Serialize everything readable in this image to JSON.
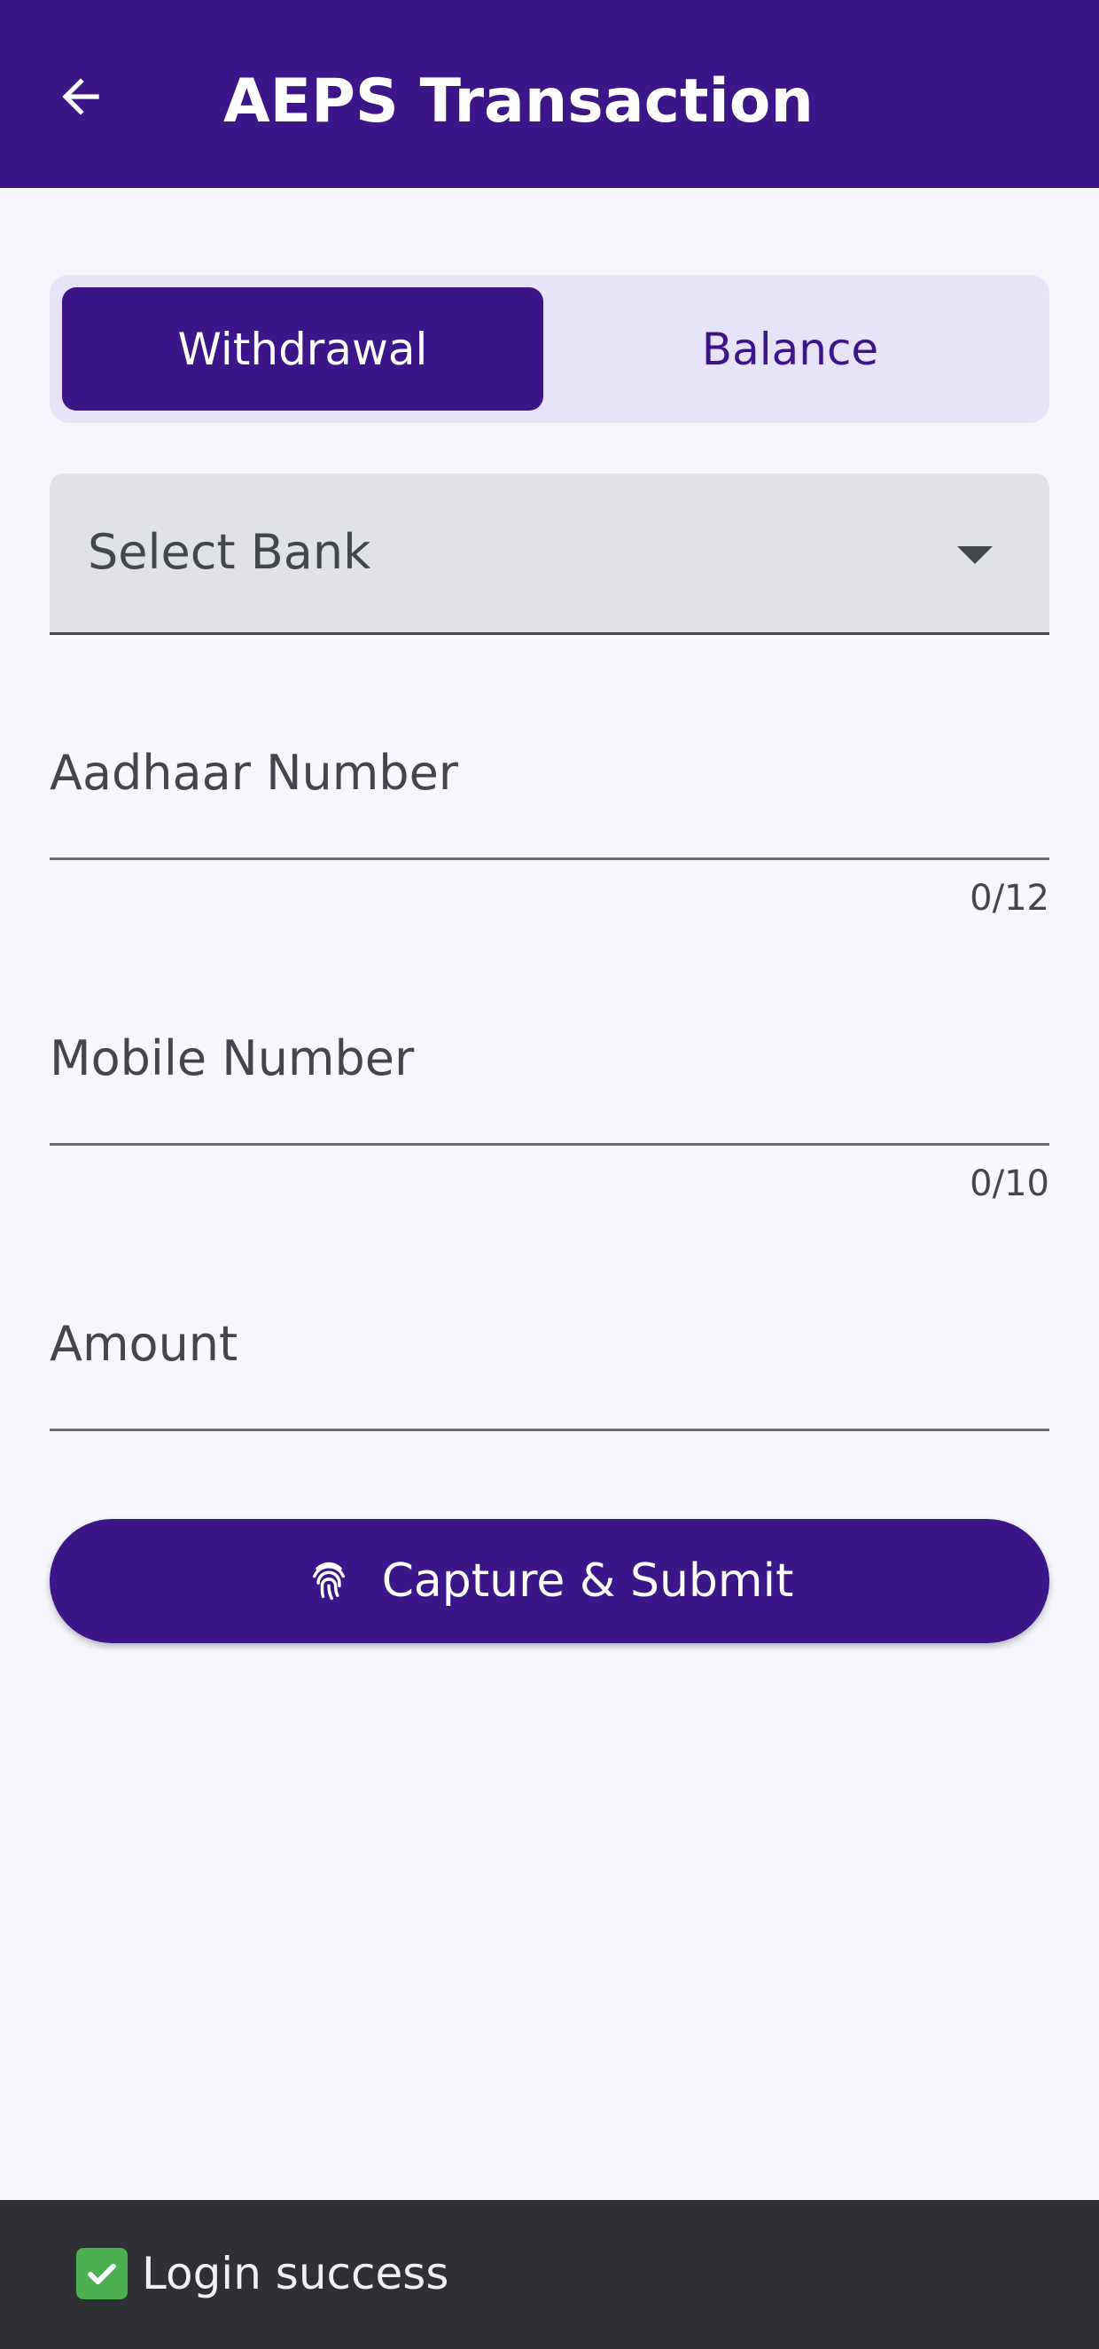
{
  "header": {
    "title": "AEPS Transaction",
    "back_icon": "arrow-left-icon"
  },
  "mode_tabs": {
    "selected": "Withdrawal",
    "items": [
      {
        "label": "Withdrawal"
      },
      {
        "label": "Balance"
      }
    ]
  },
  "form": {
    "bank_select": {
      "label": "Select Bank",
      "icon": "dropdown-arrow-icon"
    },
    "aadhaar": {
      "label": "Aadhaar Number",
      "value": "",
      "counter": "0/12"
    },
    "mobile": {
      "label": "Mobile Number",
      "value": "",
      "counter": "0/10"
    },
    "amount": {
      "label": "Amount",
      "value": ""
    },
    "submit": {
      "label": "Capture & Submit",
      "icon": "fingerprint-icon"
    }
  },
  "snackbar": {
    "icon": "check-mark-icon",
    "message": "Login success"
  },
  "colors": {
    "primary": "#3c1689",
    "tab_background": "#e7e3f8",
    "dropdown_background": "#e1e2e6",
    "page_background": "#f8f7fd",
    "snackbar_background": "#2e3034",
    "success": "#4caf50"
  }
}
